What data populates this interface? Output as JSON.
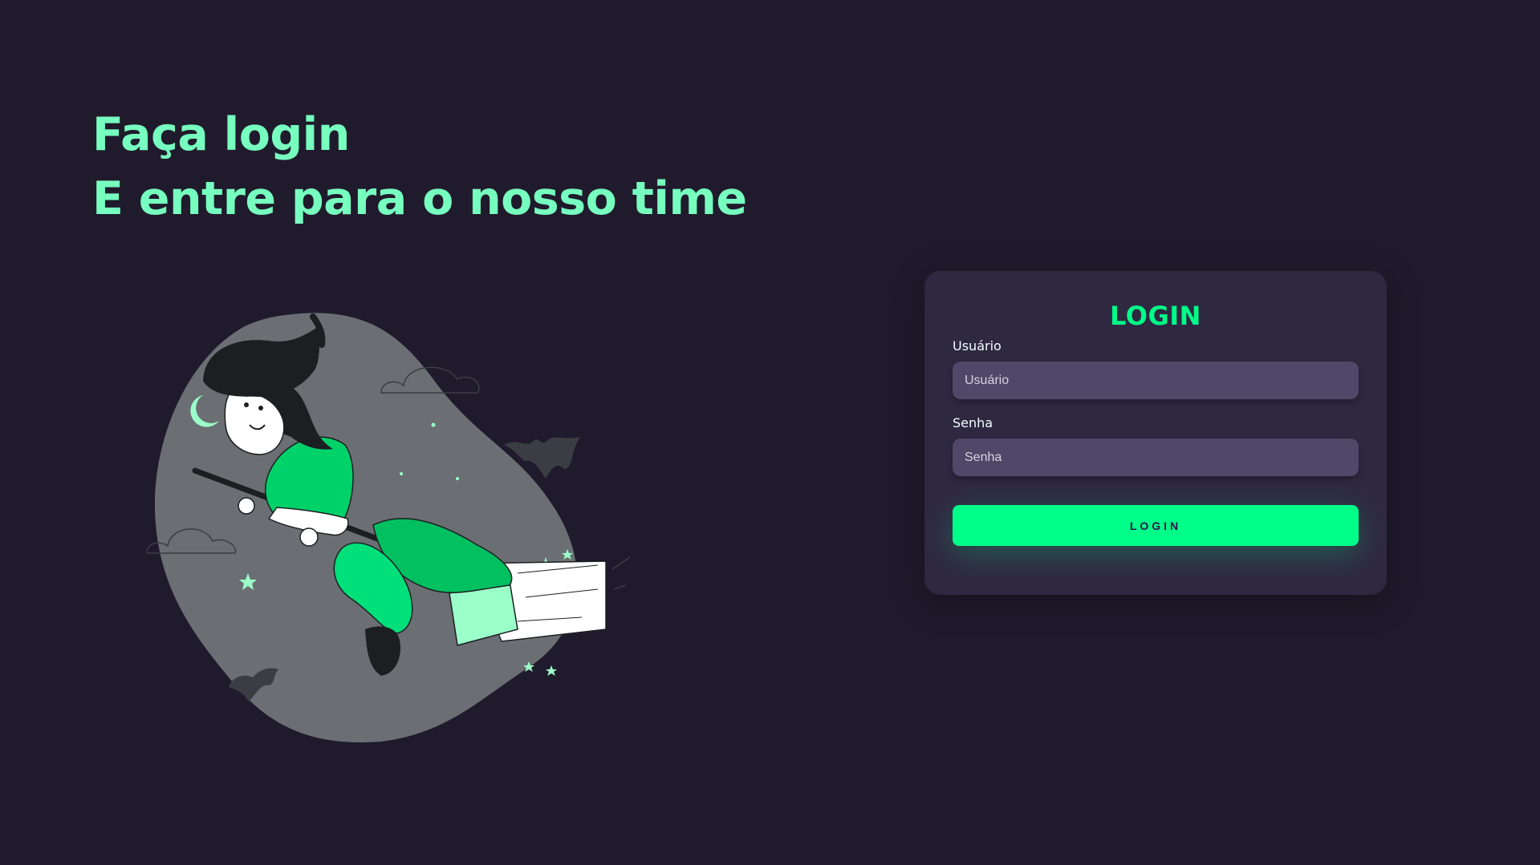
{
  "headline": {
    "line1": "Faça login",
    "line2": "E entre para o nosso time"
  },
  "illustration": {
    "subject": "witch-flying-on-broom",
    "colors": {
      "blob": "#6b6f73",
      "accent": "#00d26a",
      "accent_light": "#9bffc9",
      "dark": "#1b1f22"
    }
  },
  "login_card": {
    "title": "LOGIN",
    "username": {
      "label": "Usuário",
      "placeholder": "Usuário",
      "value": ""
    },
    "password": {
      "label": "Senha",
      "placeholder": "Senha",
      "value": ""
    },
    "submit_label": "LOGIN"
  },
  "colors": {
    "background": "#201b2c",
    "card": "#2f2841",
    "input": "#514869",
    "accent": "#00ff88",
    "headline": "#77ffc0"
  }
}
